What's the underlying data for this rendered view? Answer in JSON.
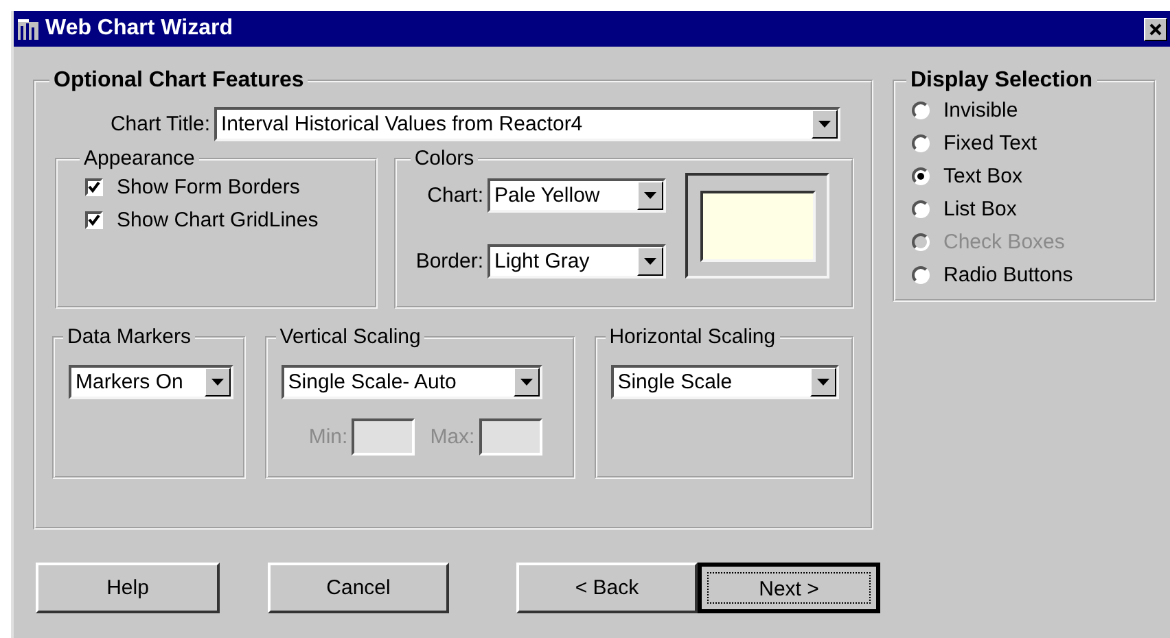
{
  "window": {
    "title": "Web Chart Wizard"
  },
  "optional_features": {
    "legend": "Optional Chart Features",
    "chart_title": {
      "label": "Chart Title:",
      "value": "Interval Historical Values from Reactor4"
    },
    "appearance": {
      "legend": "Appearance",
      "options": [
        {
          "label": "Show Form Borders",
          "checked": true
        },
        {
          "label": "Show Chart GridLines",
          "checked": true
        }
      ]
    },
    "colors": {
      "legend": "Colors",
      "fields": [
        {
          "label": "Chart:",
          "value": "Pale Yellow"
        },
        {
          "label": "Border:",
          "value": "Light Gray"
        }
      ]
    },
    "data_markers": {
      "legend": "Data Markers",
      "value": "Markers On"
    },
    "vertical_scaling": {
      "legend": "Vertical Scaling",
      "value": "Single Scale- Auto",
      "min": {
        "label": "Min:",
        "disabled": true
      },
      "max": {
        "label": "Max:",
        "disabled": true
      }
    },
    "horizontal_scaling": {
      "legend": "Horizontal Scaling",
      "value": "Single Scale"
    }
  },
  "display_selection": {
    "legend": "Display Selection",
    "options": [
      {
        "label": "Invisible",
        "selected": false,
        "disabled": false
      },
      {
        "label": "Fixed Text",
        "selected": false,
        "disabled": false
      },
      {
        "label": "Text Box",
        "selected": true,
        "disabled": false
      },
      {
        "label": "List Box",
        "selected": false,
        "disabled": false
      },
      {
        "label": "Check Boxes",
        "selected": false,
        "disabled": true
      },
      {
        "label": "Radio Buttons",
        "selected": false,
        "disabled": false
      }
    ]
  },
  "buttons": [
    {
      "label": "Help",
      "default": false
    },
    {
      "label": "Cancel",
      "default": false
    },
    {
      "label": "< Back",
      "default": false
    },
    {
      "label": "Next >",
      "default": true
    }
  ]
}
